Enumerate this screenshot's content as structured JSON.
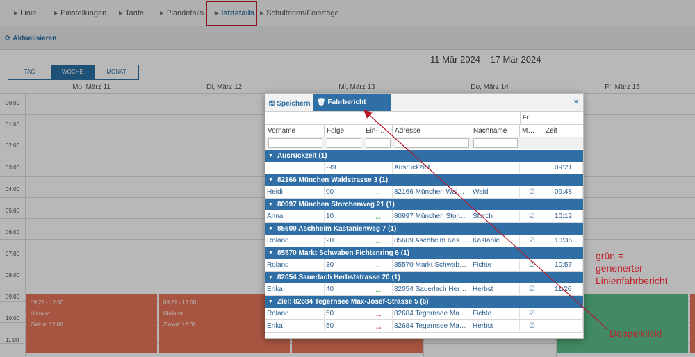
{
  "tabs": [
    {
      "label": "Linie"
    },
    {
      "label": "Einstellungen"
    },
    {
      "label": "Tarife"
    },
    {
      "label": "Plandetails"
    },
    {
      "label": "Istdetails"
    },
    {
      "label": "Schulferien/Feiertage"
    }
  ],
  "toolbar": {
    "refresh_label": "Aktualisieren"
  },
  "calendar": {
    "range": "11 Mär 2024 – 17 Mär 2024",
    "views": [
      "TAG",
      "WOCHE",
      "MONAT"
    ],
    "days": [
      "Mo, März 11",
      "Di, März 12",
      "Mi, März 13",
      "Do, März 14",
      "Fr, März 15"
    ],
    "hours": [
      "00:00",
      "01:00",
      "02:00",
      "03:00",
      "04:00",
      "05:00",
      "06:00",
      "07:00",
      "08:00",
      "09:00",
      "10:00",
      "11:00"
    ],
    "events": [
      {
        "time": "09:21 - 12:00",
        "type": "Hinfahrt",
        "target": "Zielort: 12:00"
      },
      {
        "time": "09:21 - 12:00",
        "type": "Hinfahrt",
        "target": "Zielort: 12:00"
      }
    ]
  },
  "dialog": {
    "save_label": "Speichern",
    "delete_label": "Fahrbericht löschen",
    "close_label": "×",
    "columns": {
      "vorname": "Vorname",
      "folge": "Folge",
      "einaus": "Ein-…",
      "adresse": "Adresse",
      "nachname": "Nachname",
      "fr_top": "Fr",
      "fr": "M…",
      "zeit": "Zeit"
    },
    "groups": [
      {
        "title": "Ausrückzeit (1)",
        "rows": [
          {
            "vorname": "",
            "folge": "-99",
            "dir": "",
            "adresse": "Ausrückzeit",
            "nachname": "",
            "check": false,
            "zeit": "09:21"
          }
        ]
      },
      {
        "title": "82166 München Waldstrasse 3 (1)",
        "rows": [
          {
            "vorname": "Heidi",
            "folge": "00",
            "dir": "in",
            "adresse": "82166 München Wal…",
            "nachname": "Wald",
            "check": true,
            "zeit": "09:48"
          }
        ]
      },
      {
        "title": "80997 München Storchenweg 21 (1)",
        "rows": [
          {
            "vorname": "Anna",
            "folge": "10",
            "dir": "in",
            "adresse": "80997 München Stor…",
            "nachname": "Storch",
            "check": true,
            "zeit": "10:12"
          }
        ]
      },
      {
        "title": "85609 Aschheim Kastanienweg 7 (1)",
        "rows": [
          {
            "vorname": "Roland",
            "folge": "20",
            "dir": "in",
            "adresse": "85609 Aschheim Kas…",
            "nachname": "Kastanie",
            "check": true,
            "zeit": "10:36"
          }
        ]
      },
      {
        "title": "85570 Markt Schwaben Fichtenring 6 (1)",
        "rows": [
          {
            "vorname": "Roland",
            "folge": "30",
            "dir": "in",
            "adresse": "85570 Markt Schwab…",
            "nachname": "Fichte",
            "check": true,
            "zeit": "10:57"
          }
        ]
      },
      {
        "title": "82054 Sauerlach Herbststrasse 20 (1)",
        "rows": [
          {
            "vorname": "Erika",
            "folge": "40",
            "dir": "in",
            "adresse": "82054 Sauerlach Her…",
            "nachname": "Herbst",
            "check": true,
            "zeit": "11:26"
          }
        ]
      },
      {
        "title": "Ziel: 82684 Tegernsee Max-Josef-Strasse 5 (6)",
        "rows": [
          {
            "vorname": "Roland",
            "folge": "50",
            "dir": "out",
            "adresse": "82684 Tegernsee Ma…",
            "nachname": "Fichte",
            "check": true,
            "zeit": ""
          },
          {
            "vorname": "Erika",
            "folge": "50",
            "dir": "out",
            "adresse": "82684 Tegernsee Ma…",
            "nachname": "Herbst",
            "check": true,
            "zeit": ""
          }
        ]
      }
    ]
  },
  "annotations": {
    "green_note": [
      "grün =",
      "generierter",
      "Linienfahrbericht"
    ],
    "dblclick_note": "Doppelklick!"
  },
  "colors": {
    "accent": "#2f6fa6",
    "highlight": "#c0212b",
    "event_red": "#e8765a",
    "event_green": "#5bbf8a"
  }
}
